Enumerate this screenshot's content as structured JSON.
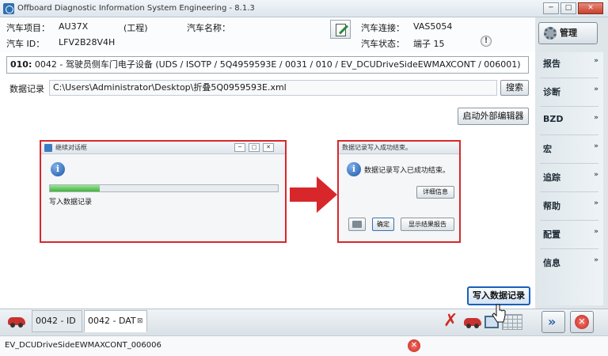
{
  "window": {
    "title": "Offboard Diagnostic Information System Engineering - 8.1.3",
    "min_label": "─",
    "max_label": "□",
    "close_label": "✕"
  },
  "info": {
    "project_label": "汽车项目：",
    "project_value": "AU37X",
    "project_type": "(工程)",
    "vehicle_name_label": "汽车名称：",
    "vin_label": "汽车 ID：",
    "vin_value": "LFV2B28V4H",
    "connection_label": "汽车连接：",
    "connection_value": "VAS5054",
    "status_label": "汽车状态：",
    "status_value": "端子 15",
    "warn_glyph": "!"
  },
  "manage_label": "管理",
  "sidebar": {
    "items": [
      {
        "label": "报告"
      },
      {
        "label": "诊断"
      },
      {
        "label": "BZD"
      },
      {
        "label": "宏"
      },
      {
        "label": "追踪"
      },
      {
        "label": "帮助"
      },
      {
        "label": "配置"
      },
      {
        "label": "信息"
      }
    ],
    "chevron": "»"
  },
  "main": {
    "path_prefix": "010:",
    "path_text": " 0042 - 驾驶员侧车门电子设备  (UDS / ISOTP / 5Q4959593E / 0031 / 010 / EV_DCUDriveSideEWMAXCONT / 006001)",
    "log_label": "数据记录",
    "file_path": "C:\\Users\\Administrator\\Desktop\\折叠5Q0959593E.xml",
    "search_label": "搜索",
    "external_editor_label": "启动外部编辑器",
    "write_label": "写入数据记录"
  },
  "dialog_progress": {
    "title": "继续对话框",
    "info_glyph": "i",
    "progress": 0.22,
    "message": "写入数据记录"
  },
  "dialog_result": {
    "title": "数据记录写入成功结束。",
    "info_glyph": "i",
    "message": "数据记录写入已成功结束。",
    "details_label": "详细信息",
    "ok_label": "确定",
    "report_label": "显示结果报告"
  },
  "tabs": [
    {
      "label": "0042 - ID"
    },
    {
      "label": "0042 - DAT"
    }
  ],
  "tab_close": "⊠",
  "status_text": "EV_DCUDriveSideEWMAXCONT_006006",
  "colors": {
    "highlight_red": "#d8272b",
    "accent_blue": "#1d5fb8"
  }
}
